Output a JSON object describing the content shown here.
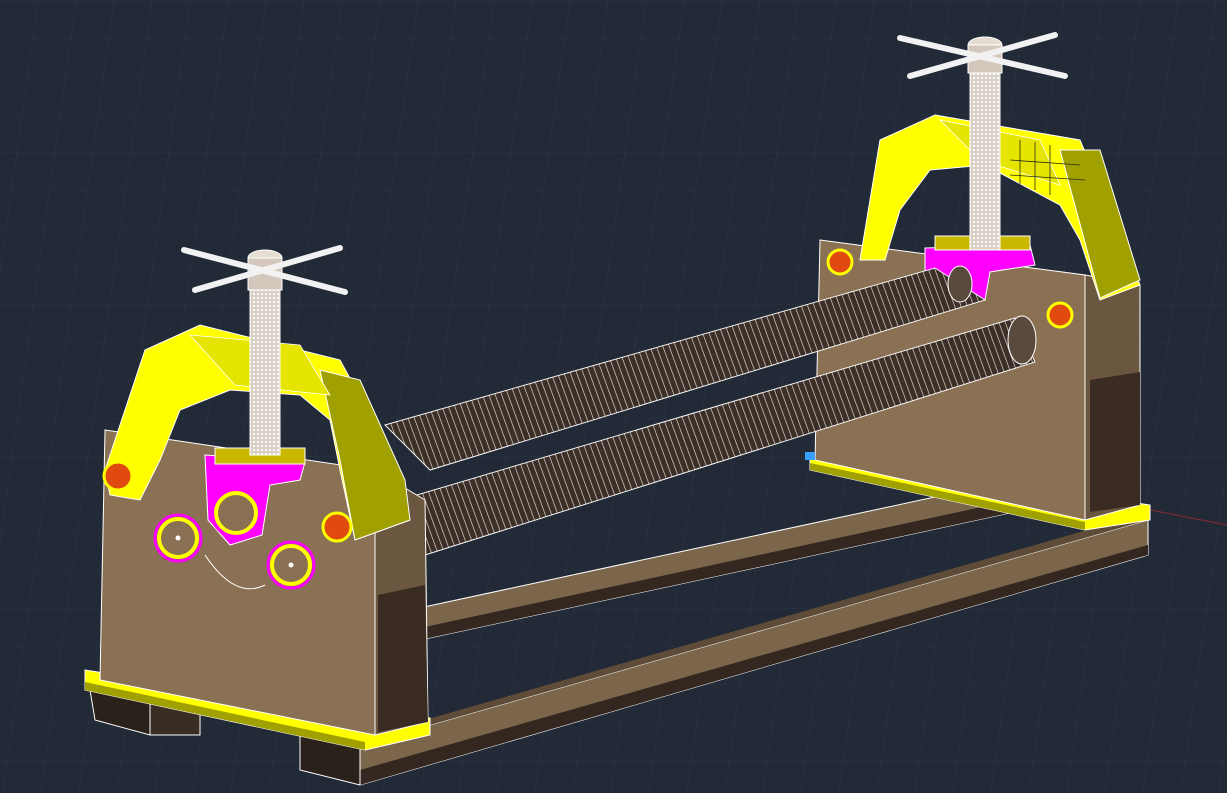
{
  "viewport": {
    "background": "#212a36",
    "grid_color": "#2c3744",
    "axis_x_color": "#8a2a35"
  },
  "model": {
    "description_type": "3d-wireframe-shaded-cad-model",
    "colors": {
      "frame_yellow": "#ffff00",
      "frame_yellow_shade": "#a0a000",
      "side_plate": "#8b7153",
      "side_plate_dark": "#3a2c22",
      "base_rail": "#7b654b",
      "base_rail_dark": "#33271f",
      "bearing_magenta": "#ff00ff",
      "pin_orange": "#e04a10",
      "roller_lines": "#ffffff",
      "screw_white": "#f2f2f2"
    },
    "icons": [
      "handwheel-icon",
      "lead-screw-icon",
      "roller-icon",
      "bearing-ring-icon",
      "pivot-pin-icon"
    ]
  }
}
